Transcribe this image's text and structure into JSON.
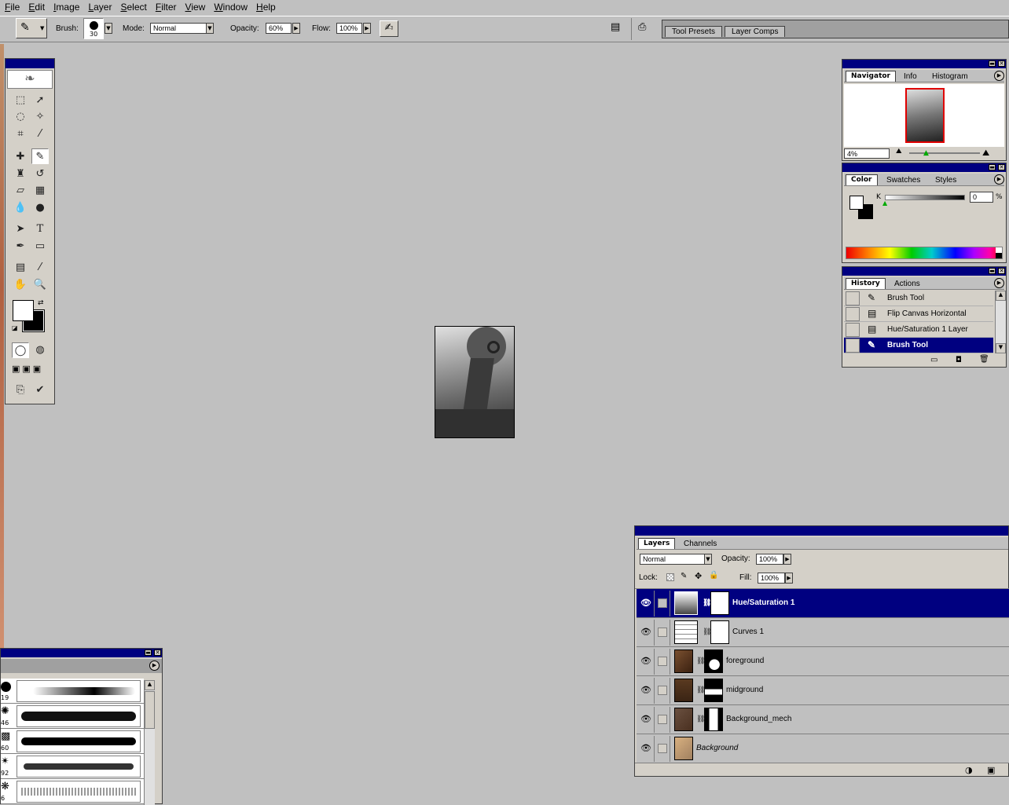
{
  "menu": [
    "File",
    "Edit",
    "Image",
    "Layer",
    "Select",
    "Filter",
    "View",
    "Window",
    "Help"
  ],
  "options": {
    "brush_label": "Brush:",
    "brush_size": "30",
    "mode_label": "Mode:",
    "mode_value": "Normal",
    "opacity_label": "Opacity:",
    "opacity_value": "60%",
    "flow_label": "Flow:",
    "flow_value": "100%"
  },
  "palette_well": {
    "tabs": [
      "Tool Presets",
      "Layer Comps"
    ]
  },
  "navigator": {
    "tabs": [
      "Navigator",
      "Info",
      "Histogram"
    ],
    "zoom": "4%"
  },
  "color": {
    "tabs": [
      "Color",
      "Swatches",
      "Styles"
    ],
    "channel_label": "K",
    "value": "0",
    "unit": "%"
  },
  "history": {
    "tabs": [
      "History",
      "Actions"
    ],
    "items": [
      {
        "label": "Brush Tool",
        "icon": "brush-icon"
      },
      {
        "label": "Flip Canvas Horizontal",
        "icon": "document-icon"
      },
      {
        "label": "Hue/Saturation 1 Layer",
        "icon": "document-icon"
      },
      {
        "label": "Brush Tool",
        "icon": "brush-icon",
        "selected": true
      }
    ]
  },
  "layers": {
    "tabs": [
      "Layers",
      "Channels"
    ],
    "blend": "Normal",
    "opacity_label": "Opacity:",
    "opacity": "100%",
    "lock_label": "Lock:",
    "fill_label": "Fill:",
    "fill": "100%",
    "items": [
      {
        "name": "Hue/Saturation 1",
        "selected": true
      },
      {
        "name": "Curves 1"
      },
      {
        "name": "foreground"
      },
      {
        "name": "midground"
      },
      {
        "name": "Background_mech"
      },
      {
        "name": "Background"
      }
    ]
  },
  "brushes": {
    "sizes": [
      "19",
      "46",
      "60",
      "92",
      "6"
    ]
  },
  "colors": {
    "title_blue": "#000080",
    "workspace": "#c0c0c0",
    "panel": "#d4d0c8"
  }
}
